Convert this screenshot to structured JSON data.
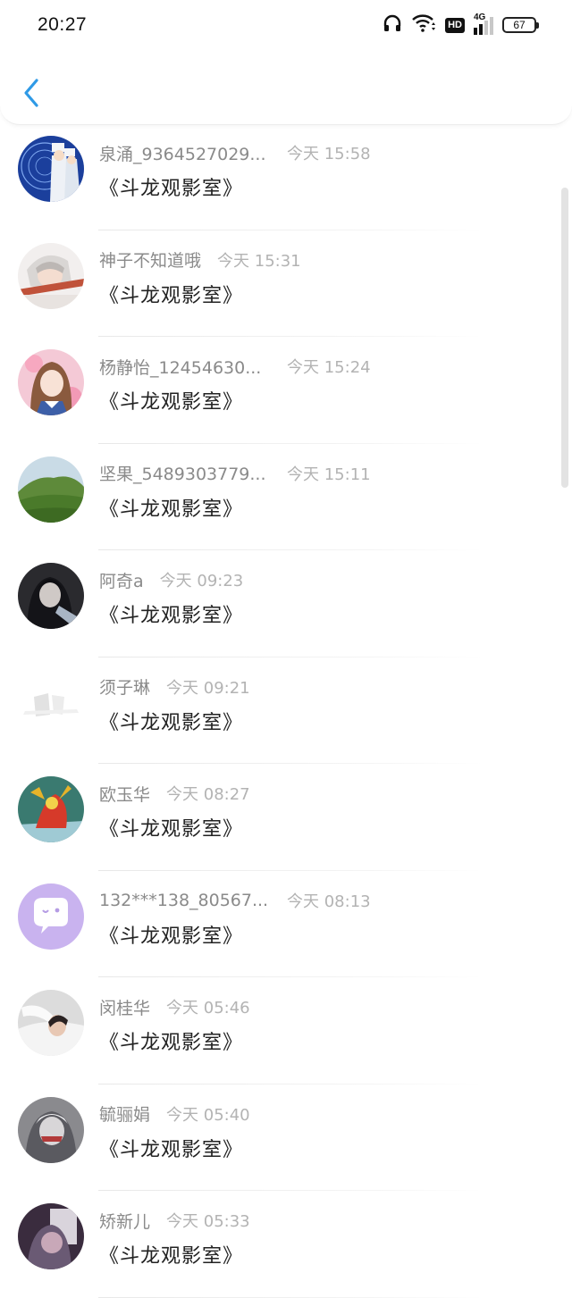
{
  "status_bar": {
    "time": "20:27",
    "hd": "HD",
    "network": "4G",
    "battery": "67"
  },
  "header": {
    "back_icon": "chevron-left-icon",
    "accent_color": "#2f9ae6"
  },
  "items": [
    {
      "name": "泉涌_9364527029...",
      "time": "今天 15:58",
      "content": "《斗龙观影室》"
    },
    {
      "name": "神子不知道哦",
      "time": "今天 15:31",
      "content": "《斗龙观影室》"
    },
    {
      "name": "杨静怡_12454630...",
      "time": "今天 15:24",
      "content": "《斗龙观影室》"
    },
    {
      "name": "坚果_5489303779...",
      "time": "今天 15:11",
      "content": "《斗龙观影室》"
    },
    {
      "name": "阿奇a",
      "time": "今天 09:23",
      "content": "《斗龙观影室》"
    },
    {
      "name": "须子琳",
      "time": "今天 09:21",
      "content": "《斗龙观影室》"
    },
    {
      "name": "欧玉华",
      "time": "今天 08:27",
      "content": "《斗龙观影室》"
    },
    {
      "name": "132***138_80567...",
      "time": "今天 08:13",
      "content": "《斗龙观影室》"
    },
    {
      "name": "闵桂华",
      "time": "今天 05:46",
      "content": "《斗龙观影室》"
    },
    {
      "name": "毓骊娟",
      "time": "今天 05:40",
      "content": "《斗龙观影室》"
    },
    {
      "name": "矫新儿",
      "time": "今天 05:33",
      "content": "《斗龙观影室》"
    }
  ]
}
